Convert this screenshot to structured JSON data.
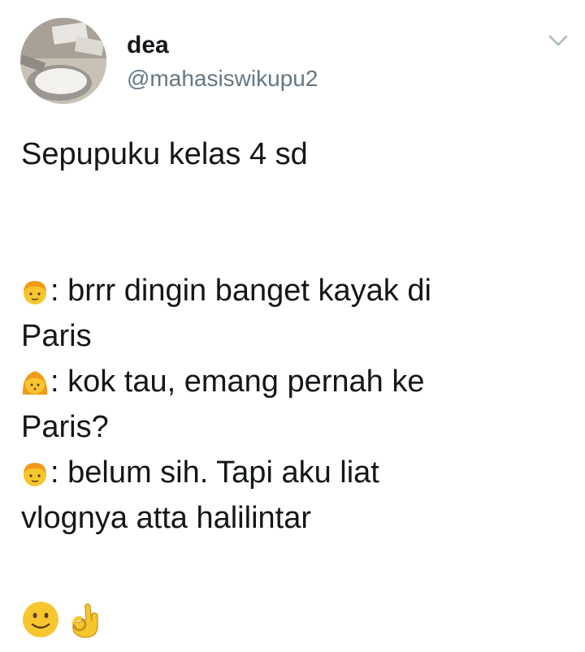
{
  "author": {
    "name": "dea",
    "handle": "@mahasiswikupu2"
  },
  "tweet": {
    "intro": "Sepupuku kelas 4 sd",
    "dialogue": [
      {
        "speaker_icon": "boy-emoji",
        "line1": ": brrr dingin banget kayak di",
        "line2": "Paris"
      },
      {
        "speaker_icon": "girl-emoji",
        "line1": ": kok tau, emang pernah ke",
        "line2": "Paris?"
      },
      {
        "speaker_icon": "boy-emoji",
        "line1": ": belum sih. Tapi aku liat",
        "line2": "vlognya atta halilintar"
      }
    ],
    "closing_icons": [
      "slightly-smiling-face-emoji",
      "ok-hand-emoji"
    ]
  },
  "colors": {
    "text": "#14171a",
    "secondary_text": "#657786",
    "emoji_yellow": "#f7c62f",
    "hair_orange": "#f19a1a"
  }
}
